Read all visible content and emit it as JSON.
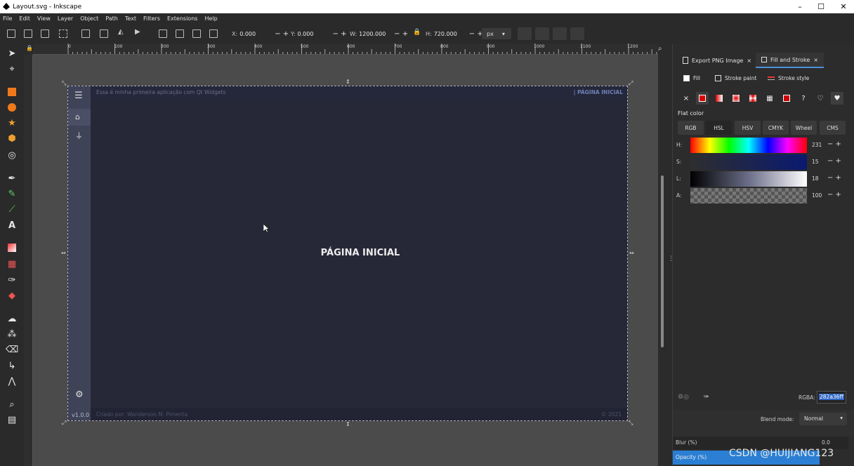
{
  "window": {
    "title": "Layout.svg - Inkscape"
  },
  "menu": [
    "File",
    "Edit",
    "View",
    "Layer",
    "Object",
    "Path",
    "Text",
    "Filters",
    "Extensions",
    "Help"
  ],
  "toolbar": {
    "x_label": "X:",
    "x_value": "0.000",
    "y_label": "Y:",
    "y_value": "0.000",
    "w_label": "W:",
    "w_value": "1200.000",
    "h_label": "H:",
    "h_value": "720.000",
    "unit": "px",
    "plus_minus": "− +"
  },
  "ruler": {
    "labels": [
      "0",
      "100",
      "200",
      "300",
      "400",
      "500",
      "600",
      "700",
      "800",
      "900",
      "1000",
      "1100",
      "1200"
    ]
  },
  "document": {
    "topbar_text": "Essa é minha primeira aplicação com Qt Widgets",
    "topbar_right": "| PÁGINA INICIAL",
    "center_title": "PÁGINA INICIAL",
    "version": "v1.0.0",
    "footer_left": "Criado por: Wanderson M. Pimenta",
    "footer_right": "© 2021",
    "bg_color": "#282a36"
  },
  "panel": {
    "tabs": [
      {
        "label": "Export PNG Image",
        "close": "×"
      },
      {
        "label": "Fill and Stroke",
        "close": "×"
      }
    ],
    "subtabs": [
      "Fill",
      "Stroke paint",
      "Stroke style"
    ],
    "fill_types": [
      "×",
      "?"
    ],
    "flat_color_label": "Flat color",
    "modes": [
      "RGB",
      "HSL",
      "HSV",
      "CMYK",
      "Wheel",
      "CMS"
    ],
    "active_mode": "HSL",
    "sliders": [
      {
        "label": "H:",
        "value": "231"
      },
      {
        "label": "S:",
        "value": "15"
      },
      {
        "label": "L:",
        "value": "18"
      },
      {
        "label": "A:",
        "value": "100"
      }
    ],
    "rgba_label": "RGBA:",
    "rgba_value": "282a36ff",
    "blend_label": "Blend mode:",
    "blend_value": "Normal",
    "blur_label": "Blur (%)",
    "blur_value": "0.0",
    "opacity_label": "Opacity (%)"
  },
  "watermark": "CSDN @HUIJIANG123"
}
